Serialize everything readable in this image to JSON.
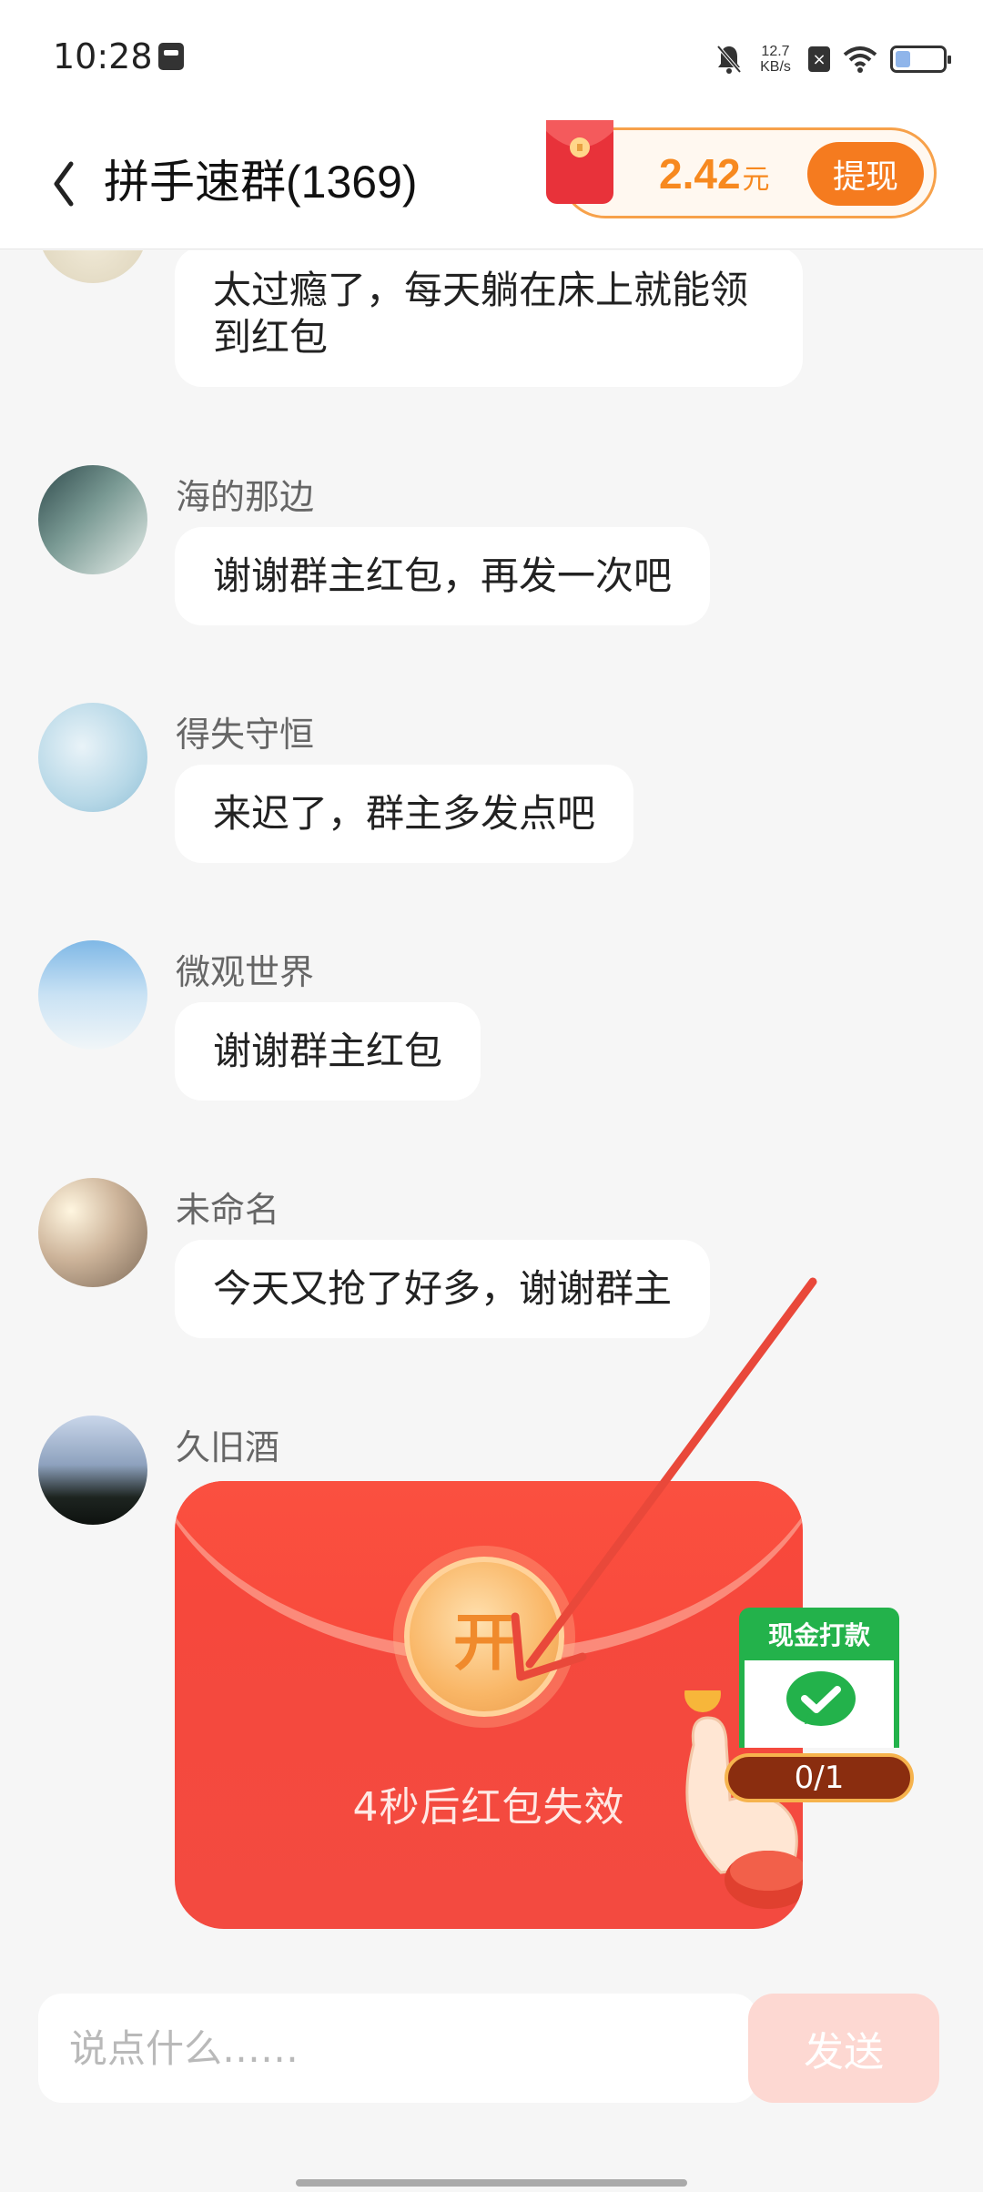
{
  "status_bar": {
    "time": "10:28",
    "net_speed_value": "12.7",
    "net_speed_unit": "KB/s",
    "icons": [
      "screenshot-icon",
      "mute-icon",
      "sim-x-icon",
      "wifi-icon",
      "battery-icon"
    ]
  },
  "header": {
    "title": "拼手速群(1369)",
    "reward_amount": "2.42",
    "reward_unit": "元",
    "withdraw_label": "提现"
  },
  "messages": [
    {
      "sender": "",
      "text": "太过瘾了，每天躺在床上就能领到红包"
    },
    {
      "sender": "海的那边",
      "text": "谢谢群主红包，再发一次吧"
    },
    {
      "sender": "得失守恒",
      "text": "来迟了，群主多发点吧"
    },
    {
      "sender": "微观世界",
      "text": "谢谢群主红包"
    },
    {
      "sender": "未命名",
      "text": "今天又抢了好多，谢谢群主"
    },
    {
      "sender": "久旧酒",
      "text": ""
    }
  ],
  "red_packet": {
    "open_label": "开",
    "countdown_text": "4秒后红包失效"
  },
  "cash_badge": {
    "title": "现金打款",
    "progress": "0/1"
  },
  "input_bar": {
    "placeholder": "说点什么……",
    "send_label": "发送"
  },
  "colors": {
    "accent_orange": "#f57b1f",
    "packet_red": "#f4493e",
    "wechat_green": "#23b24b"
  }
}
